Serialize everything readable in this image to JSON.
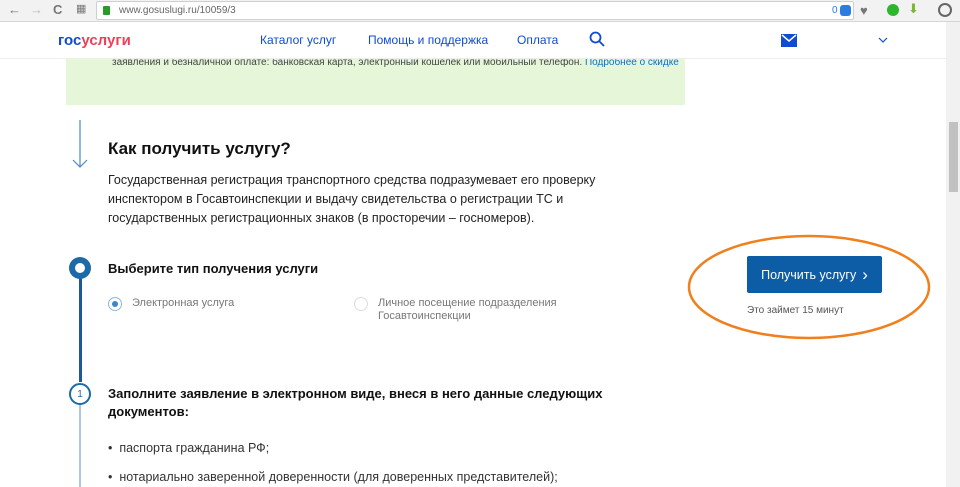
{
  "browser": {
    "url": "www.gosuslugi.ru/10059/3",
    "badge_count": "0"
  },
  "header": {
    "logo_part1": "гос",
    "logo_part2": "услуги",
    "nav": [
      "Каталог услуг",
      "Помощь и поддержка",
      "Оплата"
    ]
  },
  "promo": {
    "text": "заявления и безналичной оплате: банковская карта, электронный кошелек или мобильный телефон.",
    "link": "Подробнее о скидке"
  },
  "main": {
    "title": "Как получить услугу?",
    "description": "Государственная регистрация транспортного средства подразумевает его проверку инспектором в Госавтоинспекции и выдачу свидетельства о регистрации ТС и государственных регистрационных знаков (в просторечии – госномеров).",
    "step0": {
      "title": "Выберите тип получения услуги",
      "options": [
        {
          "label": "Электронная услуга",
          "selected": true
        },
        {
          "label": "Личное посещение подразделения Госавтоинспекции",
          "selected": false
        }
      ]
    },
    "step1": {
      "number": "1",
      "title": "Заполните заявление в электронном виде, внеся в него данные следующих документов:",
      "items": [
        "паспорта гражданина РФ;",
        "нотариально заверенной доверенности (для доверенных представителей);"
      ]
    }
  },
  "cta": {
    "button": "Получить услугу",
    "button_icon": "›",
    "note": "Это займет 15 минут"
  },
  "colors": {
    "accent": "#0d5ca6",
    "highlight": "#f07f1d",
    "promo_bg": "#e6f6d8"
  }
}
